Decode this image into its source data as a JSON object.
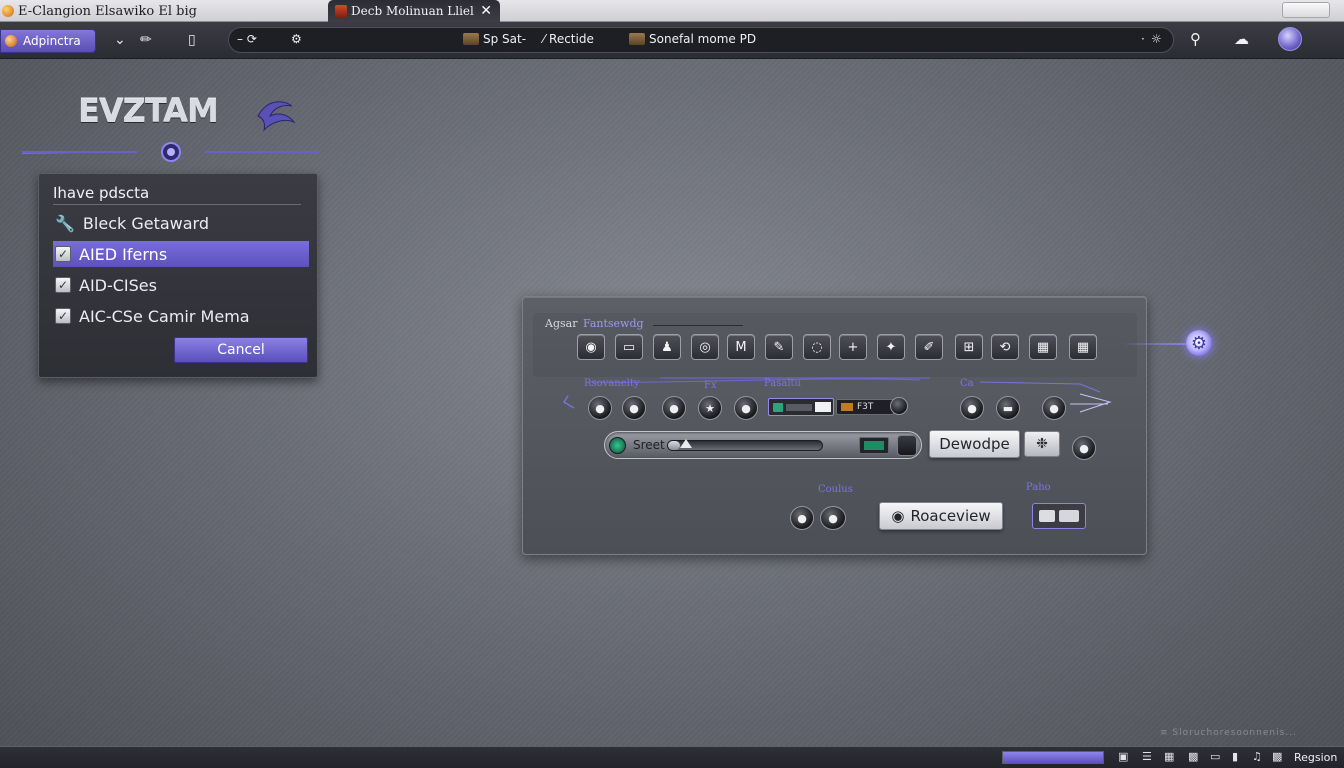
{
  "window": {
    "app_title": "E-Clangion Elsawiko El big",
    "active_tab": "Decb Molinuan Lliel",
    "tab_close": "✕"
  },
  "toolbar": {
    "app_button_label": "Adpinctra",
    "address_items": [
      {
        "label": "Sp Sat-",
        "icon": "folder-icon"
      },
      {
        "label": "Rectide",
        "icon": "pen-icon"
      },
      {
        "label": "Sonefal mome PD",
        "icon": "folder-icon"
      }
    ]
  },
  "brand": {
    "logo_text": "EVZTAM"
  },
  "menu": {
    "title": "Ihave pdscta",
    "items": [
      {
        "label": "Bleck Getaward",
        "icon": "wrench-icon",
        "selected": false
      },
      {
        "label": "AIED Iferns",
        "icon": "checkbox-icon",
        "selected": true
      },
      {
        "label": "AID-CISes",
        "icon": "checkbox-icon",
        "selected": false
      },
      {
        "label": "AIC-CSe Camir Mema",
        "icon": "checkbox-icon",
        "selected": false
      }
    ],
    "cancel_label": "Cancel"
  },
  "control_panel": {
    "header": "Agsar",
    "header_sub": "Fantsewdg",
    "icon_row": [
      "◉",
      "▭",
      "♟",
      "◎",
      "M",
      "✎",
      "◌",
      "+",
      "✦",
      "✐",
      "⊞",
      "⟲",
      "▦"
    ],
    "annotations": {
      "a1": "Rsovanelty",
      "a2": "Fx",
      "a3": "Pasaltu",
      "a4": "Ca",
      "a5": "Coulus",
      "a6": "Paho"
    },
    "mini_display_2_text": "F3T",
    "slider": {
      "label": "Sreet",
      "value": 0.08
    },
    "develop_label": "Dewodpe",
    "preview_label": "Roaceview"
  },
  "statusbar": {
    "progress": 1.0,
    "status_text": "Regsion"
  },
  "watermark": "≡ Sloruchoresoonnenis...",
  "colors": {
    "accent": "#6f62d0",
    "titlebar": "#dcdce0",
    "panel": "#3a3b42"
  }
}
